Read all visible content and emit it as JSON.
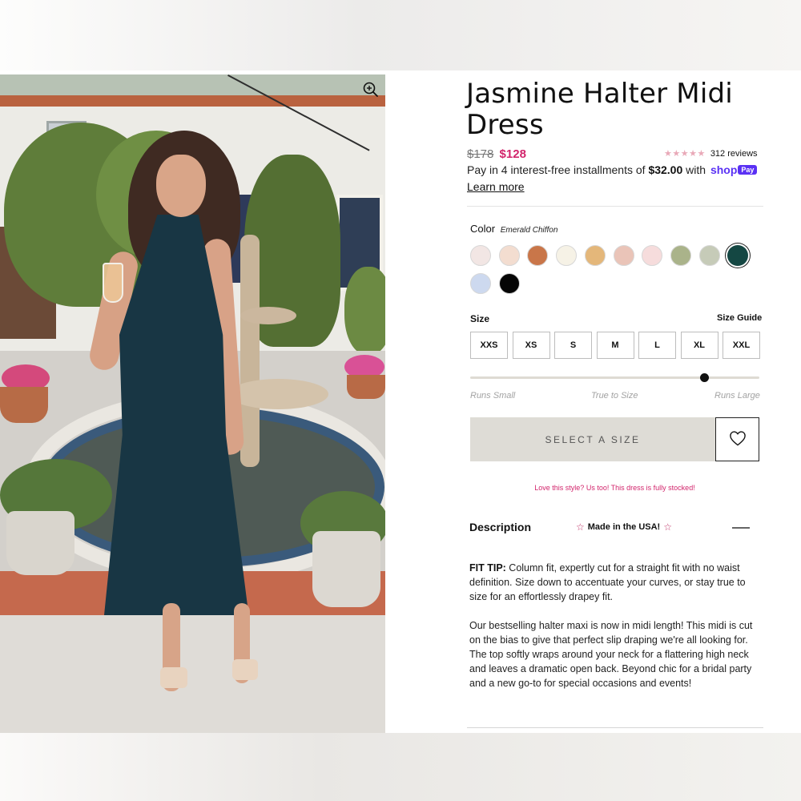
{
  "product": {
    "title": "Jasmine Halter Midi Dress",
    "price_original": "$178",
    "price_sale": "$128",
    "rating_stars": "★★★★★",
    "reviews": "312 reviews"
  },
  "installments": {
    "prefix": "Pay in 4 interest-free installments of ",
    "amount": "$32.00",
    "suffix": " with ",
    "brand": "shop",
    "brand_badge": "Pay",
    "link": "Learn more"
  },
  "color": {
    "label": "Color",
    "selected": "Emerald Chiffon",
    "swatches": [
      {
        "name": "blush",
        "hex": "#f2e6e4"
      },
      {
        "name": "nude",
        "hex": "#f3ddd0"
      },
      {
        "name": "rust",
        "hex": "#c97649"
      },
      {
        "name": "ivory",
        "hex": "#f6f2e6"
      },
      {
        "name": "gold",
        "hex": "#e4b77a"
      },
      {
        "name": "dusty-rose",
        "hex": "#eac4b8"
      },
      {
        "name": "light-pink",
        "hex": "#f6dcdc"
      },
      {
        "name": "sage",
        "hex": "#aab38a"
      },
      {
        "name": "pale-sage",
        "hex": "#c6cbb8"
      },
      {
        "name": "emerald",
        "hex": "#144743"
      },
      {
        "name": "periwinkle",
        "hex": "#cdd9ef"
      },
      {
        "name": "black",
        "hex": "#050505"
      }
    ]
  },
  "size": {
    "label": "Size",
    "guide": "Size Guide",
    "options": [
      "XXS",
      "XS",
      "S",
      "M",
      "L",
      "XL",
      "XXL"
    ],
    "fit_labels": [
      "Runs Small",
      "True to Size",
      "Runs Large"
    ],
    "fit_position": 0.81
  },
  "actions": {
    "select_size": "SELECT A SIZE",
    "stock_message": "Love this style? Us too! This dress is fully stocked!"
  },
  "description": {
    "title": "Description",
    "badge": "Made in the USA!",
    "fit_tip_label": "FIT TIP:",
    "fit_tip": " Column fit, expertly cut for a straight fit with no waist definition. Size down to accentuate your curves, or stay true to size for an effortlessly drapey fit.",
    "body": "Our bestselling halter maxi is now in midi length! This midi is cut on the bias to give that perfect slip draping we're all looking for. The top softly wraps around your neck for a flattering high neck and leaves a dramatic open back. Beyond chic for a bridal party and a new go-to for special occasions and events!"
  },
  "colors": {
    "sale": "#d2246b",
    "shop_pay": "#5a31f4",
    "button_bg": "#dedcd6"
  }
}
